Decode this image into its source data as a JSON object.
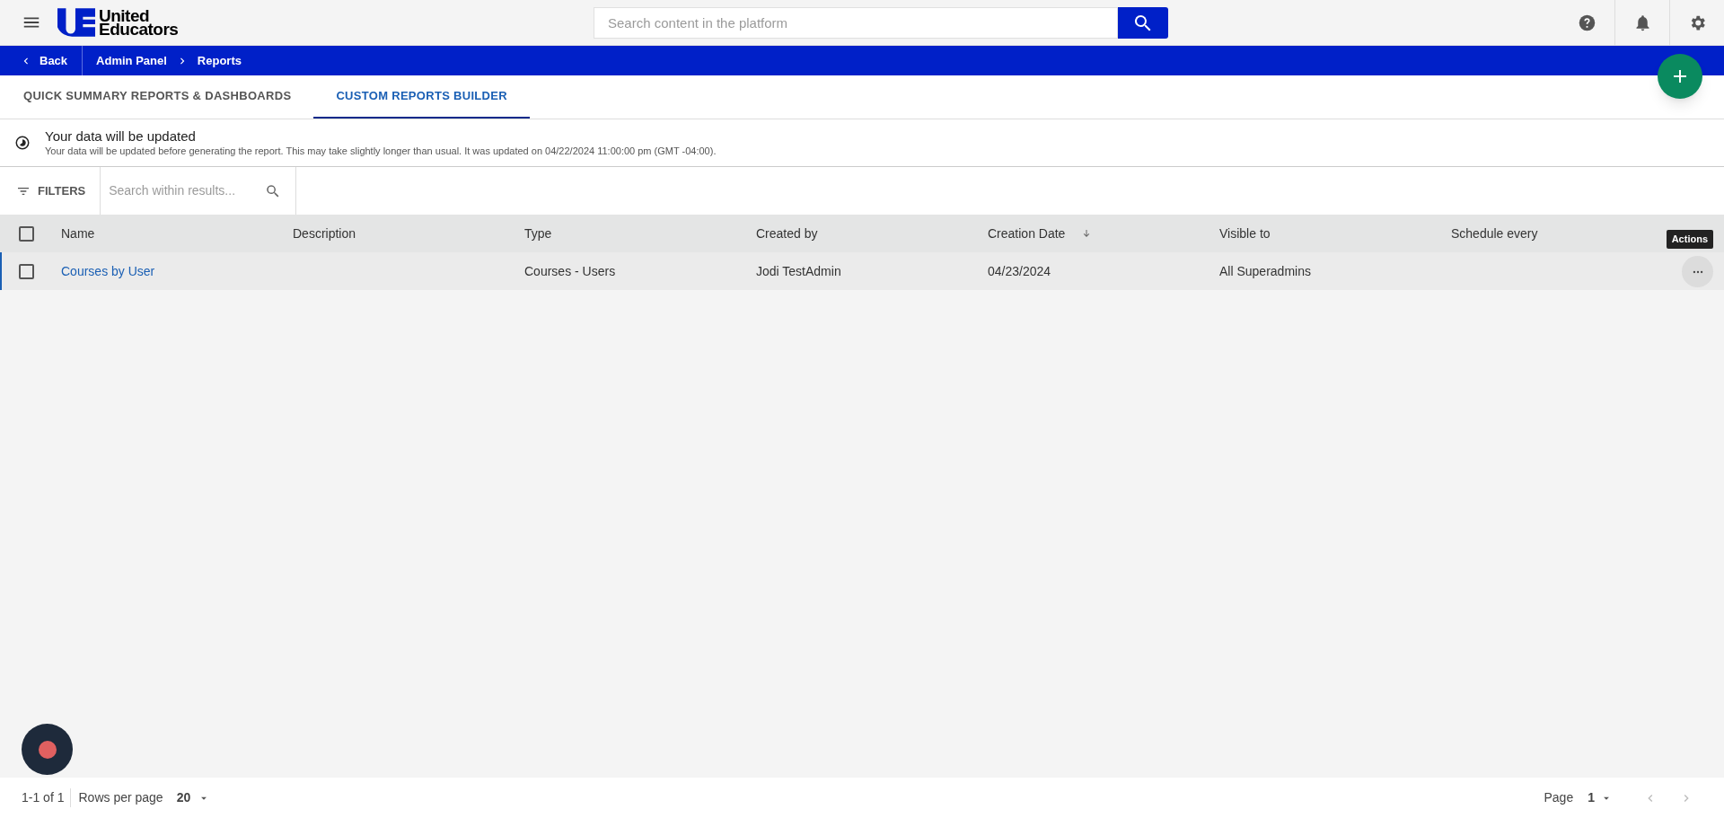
{
  "header": {
    "logo_text": [
      "United",
      "Educators"
    ],
    "search": {
      "placeholder": "Search content in the platform"
    }
  },
  "breadcrumb": {
    "back": "Back",
    "items": [
      "Admin Panel",
      "Reports"
    ]
  },
  "tabs": [
    {
      "label": "QUICK SUMMARY REPORTS & DASHBOARDS",
      "selected": false
    },
    {
      "label": "CUSTOM REPORTS BUILDER",
      "selected": true
    }
  ],
  "notice": {
    "title": "Your data will be updated",
    "text": "Your data will be updated before generating the report. This may take slightly longer than usual. It was updated on 04/22/2024 11:00:00 pm (GMT -04:00)."
  },
  "filters": {
    "label": "FILTERS",
    "search": {
      "placeholder": "Search within results..."
    }
  },
  "table": {
    "all_checked": false,
    "columns": [
      {
        "label": "Name",
        "sorted": false
      },
      {
        "label": "Description",
        "sorted": false
      },
      {
        "label": "Type",
        "sorted": false
      },
      {
        "label": "Created by",
        "sorted": false
      },
      {
        "label": "Creation Date",
        "sorted": true
      },
      {
        "label": "Visible to",
        "sorted": false
      },
      {
        "label": "Schedule every",
        "sorted": false
      }
    ],
    "actions_tooltip": "Actions",
    "rows": [
      {
        "checked": false,
        "cells": [
          "Courses by User",
          "",
          "Courses - Users",
          "Jodi TestAdmin",
          "04/23/2024",
          "All Superadmins",
          ""
        ]
      }
    ]
  },
  "footer": {
    "range": "1-1 of 1",
    "rows_label": "Rows per page",
    "rows_value": "20",
    "page_label": "Page",
    "page_value": "1"
  }
}
